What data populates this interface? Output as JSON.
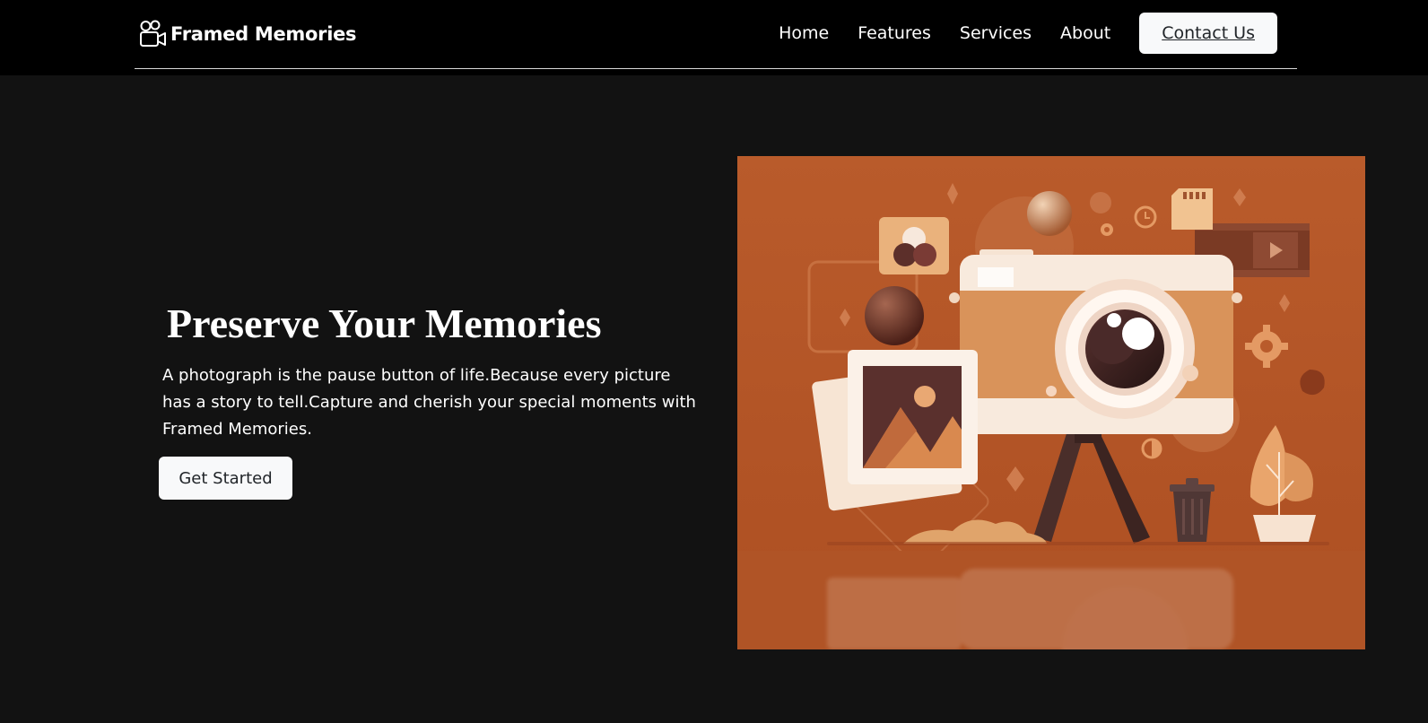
{
  "brand": {
    "name": "Framed Memories",
    "icon": "camera-reels-icon"
  },
  "nav": {
    "links": [
      "Home",
      "Features",
      "Services",
      "About"
    ],
    "contact_label": "Contact Us"
  },
  "hero": {
    "title": "Preserve Your Memories",
    "text": "A photograph is the pause button of life.Because every picture has a story to tell.Capture and cherish your special moments with Framed Memories.",
    "cta_label": "Get Started",
    "illustration": "camera-illustration"
  },
  "colors": {
    "header_bg": "#000000",
    "page_bg": "#121212",
    "illustration_bg": "#b5582a",
    "button_bg": "#f8f9fa"
  }
}
